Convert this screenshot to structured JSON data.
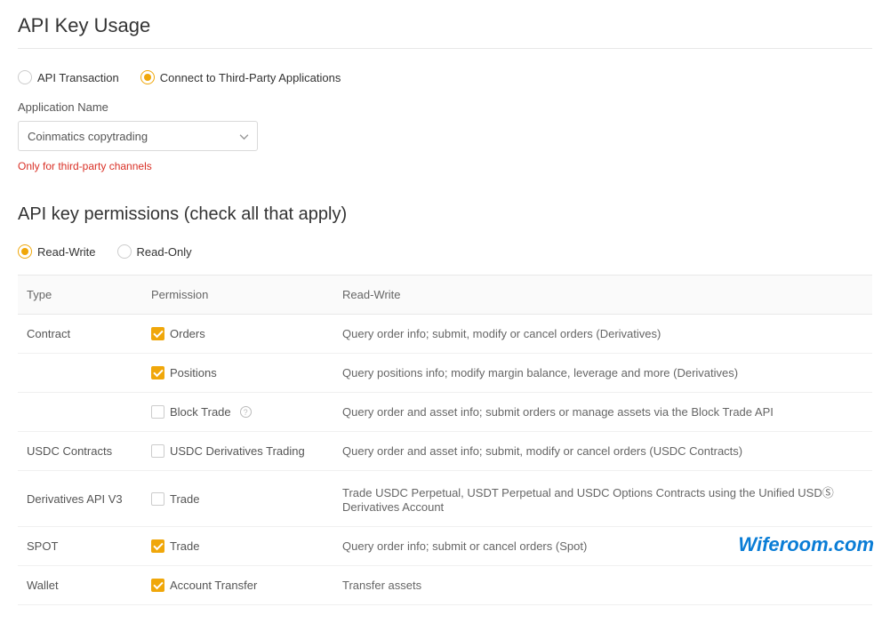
{
  "usage": {
    "title": "API Key Usage",
    "mode": {
      "api_transaction": "API Transaction",
      "third_party": "Connect to Third-Party Applications",
      "selected": "third_party"
    },
    "app_name_label": "Application Name",
    "app_name_value": "Coinmatics copytrading",
    "warning": "Only for third-party channels"
  },
  "permissions": {
    "title": "API key permissions (check all that apply)",
    "access": {
      "read_write": "Read-Write",
      "read_only": "Read-Only",
      "selected": "read_write"
    },
    "columns": {
      "type": "Type",
      "permission": "Permission",
      "readwrite": "Read-Write"
    },
    "rows": [
      {
        "type": "Contract",
        "permission": "Orders",
        "checked": true,
        "info": false,
        "desc": "Query order info; submit, modify or cancel orders (Derivatives)"
      },
      {
        "type": "",
        "permission": "Positions",
        "checked": true,
        "info": false,
        "desc": "Query positions info; modify margin balance, leverage and more (Derivatives)"
      },
      {
        "type": "",
        "permission": "Block Trade",
        "checked": false,
        "info": true,
        "desc": "Query order and asset info; submit orders or manage assets via the Block Trade API"
      },
      {
        "type": "USDC Contracts",
        "permission": "USDC Derivatives Trading",
        "checked": false,
        "info": false,
        "desc": "Query order and asset info; submit, modify or cancel orders (USDC Contracts)"
      },
      {
        "type": "Derivatives API V3",
        "permission": "Trade",
        "checked": false,
        "info": false,
        "desc": "Trade USDC Perpetual, USDT Perpetual and USDC Options Contracts using the Unified USDⓈ Derivatives Account"
      },
      {
        "type": "SPOT",
        "permission": "Trade",
        "checked": true,
        "info": false,
        "desc": "Query order info; submit or cancel orders (Spot)"
      },
      {
        "type": "Wallet",
        "permission": "Account Transfer",
        "checked": true,
        "info": false,
        "desc": "Transfer assets"
      }
    ]
  },
  "watermark": "Wiferoom.com"
}
